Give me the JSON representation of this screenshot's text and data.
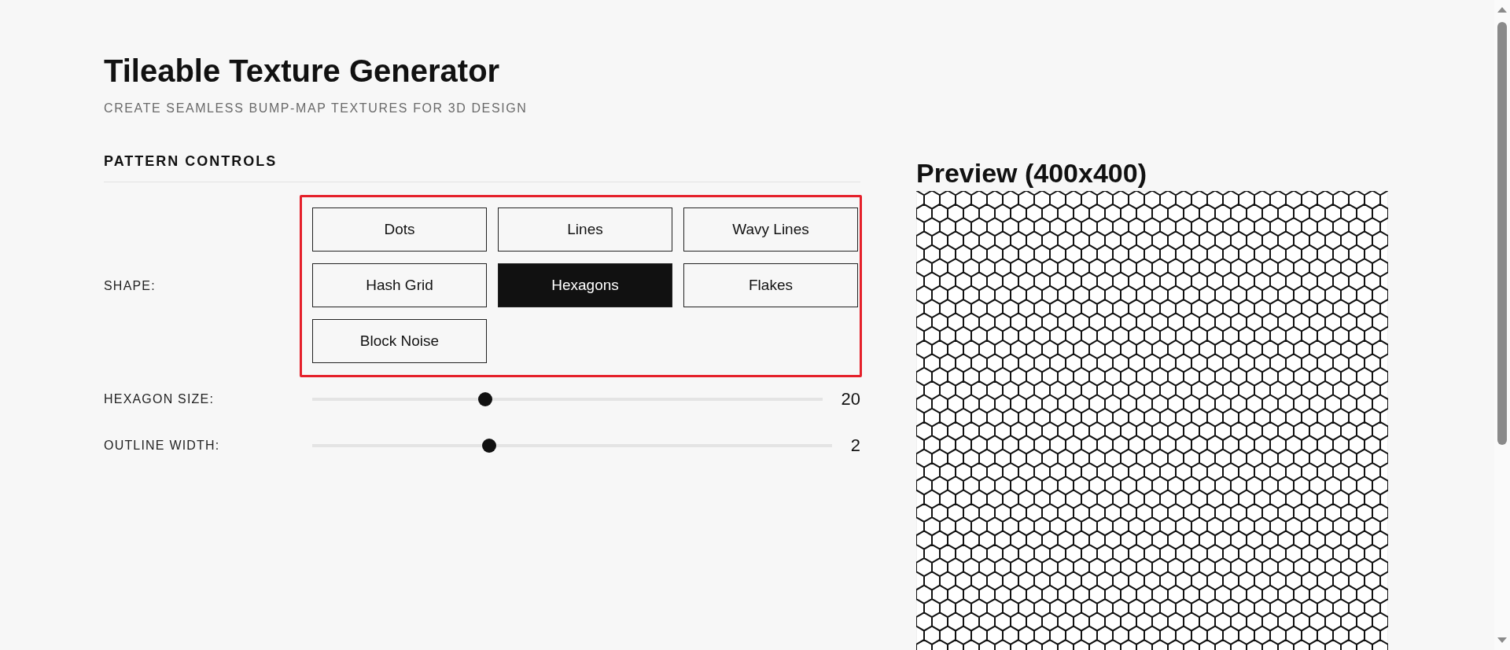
{
  "title": "Tileable Texture Generator",
  "subtitle": "CREATE SEAMLESS BUMP-MAP TEXTURES FOR 3D DESIGN",
  "controls": {
    "heading": "PATTERN CONTROLS",
    "shape": {
      "label": "SHAPE:",
      "options": [
        {
          "label": "Dots",
          "selected": false
        },
        {
          "label": "Lines",
          "selected": false
        },
        {
          "label": "Wavy Lines",
          "selected": false
        },
        {
          "label": "Hash Grid",
          "selected": false
        },
        {
          "label": "Hexagons",
          "selected": true
        },
        {
          "label": "Flakes",
          "selected": false
        },
        {
          "label": "Block Noise",
          "selected": false
        }
      ]
    },
    "sliders": [
      {
        "label": "HEXAGON SIZE:",
        "level": 0.34,
        "reading": "20"
      },
      {
        "label": "OUTLINE WIDTH:",
        "level": 0.34,
        "reading": "2"
      }
    ]
  },
  "preview": {
    "heading": "Preview (400x400)"
  }
}
